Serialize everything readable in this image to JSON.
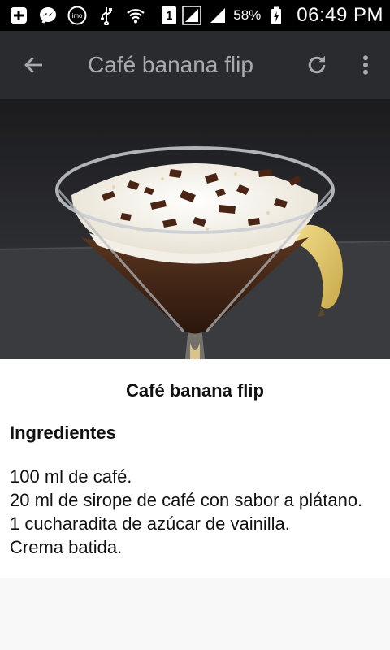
{
  "status_bar": {
    "icons": [
      "plus-box-icon",
      "messenger-icon",
      "imo-icon",
      "usb-icon",
      "wifi-icon",
      "sim-icon",
      "signal-icon",
      "signal-icon",
      "battery-charging-icon"
    ],
    "sim_label": "1",
    "imo_label": "imo",
    "battery_percent": "58%",
    "time": "06:49 PM"
  },
  "app_bar": {
    "title": "Café banana flip",
    "back_icon": "arrow-back-icon",
    "refresh_icon": "refresh-icon",
    "menu_icon": "overflow-menu-icon",
    "background_color": "#2a2b2f",
    "title_color": "#a9aaad"
  },
  "hero_image": {
    "subject": "coffee dessert in martini glass with whipped cream, chocolate shavings and banana"
  },
  "recipe": {
    "title": "Café banana flip",
    "section_heading": "Ingredientes",
    "ingredients": [
      "100 ml de café.",
      "20 ml de sirope de café con sabor a plátano.",
      "1 cucharadita de azúcar de vainilla.",
      "Crema batida."
    ]
  }
}
